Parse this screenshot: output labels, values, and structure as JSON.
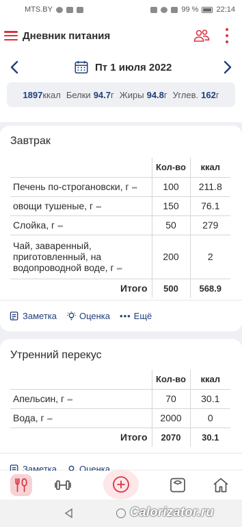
{
  "status_bar": {
    "carrier": "MTS.BY",
    "battery": "99 %",
    "time": "22:14"
  },
  "header": {
    "title": "Дневник питания",
    "menu_icon": "hamburger-icon",
    "people_icon": "people-icon",
    "more_icon": "more-vertical-icon"
  },
  "date_bar": {
    "date": "Пт 1 июля 2022"
  },
  "summary": {
    "kcal": "1897",
    "kcal_unit": "ккал",
    "protein_label": "Белки",
    "protein": "94.7",
    "protein_unit": "г",
    "fat_label": "Жиры",
    "fat": "94.8",
    "fat_unit": "г",
    "carbs_label": "Углев.",
    "carbs": "162",
    "carbs_unit": "г"
  },
  "columns": {
    "qty": "Кол-во",
    "kcal": "ккал"
  },
  "meals": [
    {
      "title": "Завтрак",
      "items": [
        {
          "name": "Печень по-строгановски, г",
          "qty": "100",
          "kcal": "211.8"
        },
        {
          "name": "овощи тушеные, г",
          "qty": "150",
          "kcal": "76.1"
        },
        {
          "name": "Слойка, г",
          "qty": "50",
          "kcal": "279"
        },
        {
          "name": "Чай, заваренный, приготовленный, на водопроводной воде, г",
          "qty": "200",
          "kcal": "2"
        }
      ],
      "total_label": "Итого",
      "total_qty": "500",
      "total_kcal": "568.9"
    },
    {
      "title": "Утренний перекус",
      "items": [
        {
          "name": "Апельсин, г",
          "qty": "70",
          "kcal": "30.1"
        },
        {
          "name": "Вода, г",
          "qty": "2000",
          "kcal": "0"
        }
      ],
      "total_label": "Итого",
      "total_qty": "2070",
      "total_kcal": "30.1"
    }
  ],
  "footer_actions": {
    "note": "Заметка",
    "rating": "Оценка",
    "more": "Ещё"
  },
  "row_more": "•••",
  "bottom_nav": [
    "food-icon",
    "dumbbell-icon",
    "add-icon",
    "scale-icon",
    "home-icon"
  ],
  "watermark": "Calorizator.ru",
  "colors": {
    "accent": "#d9323f",
    "link": "#1f3f7a"
  }
}
